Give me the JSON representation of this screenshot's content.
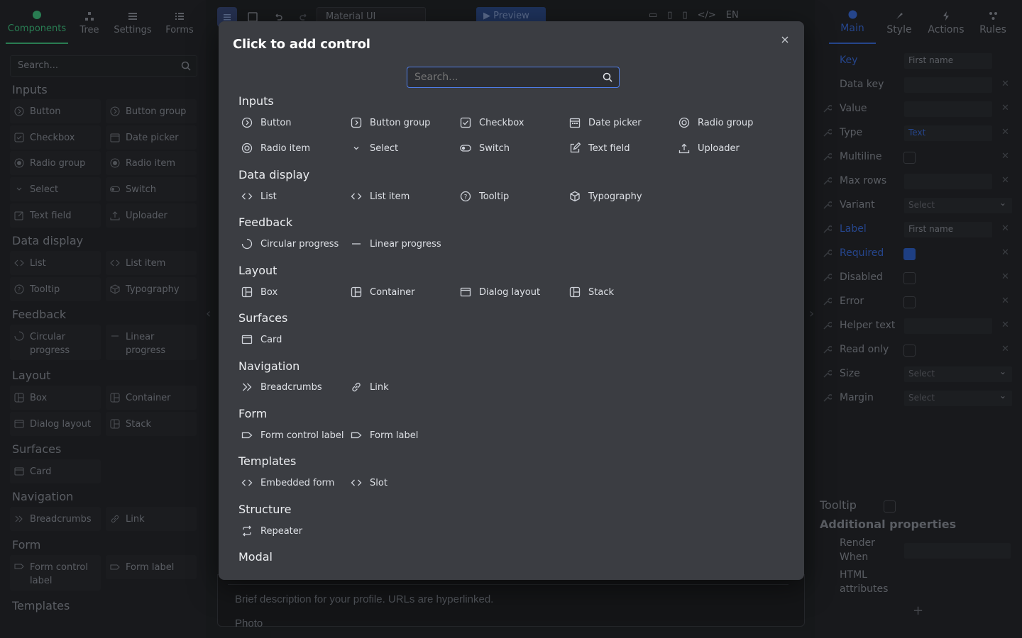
{
  "left_panel": {
    "tabs": [
      {
        "label": "Components",
        "icon": "components-icon"
      },
      {
        "label": "Tree",
        "icon": "tree-icon"
      },
      {
        "label": "Settings",
        "icon": "settings-icon"
      },
      {
        "label": "Forms",
        "icon": "forms-icon"
      }
    ],
    "search_placeholder": "Search...",
    "groups": [
      "Inputs",
      "Data display",
      "Feedback",
      "Layout",
      "Surfaces",
      "Navigation",
      "Form",
      "Templates"
    ],
    "items": {
      "button": "Button",
      "button_group": "Button group",
      "checkbox": "Checkbox",
      "date_picker": "Date picker",
      "radio_group": "Radio group",
      "radio_item": "Radio item",
      "select": "Select",
      "switch": "Switch",
      "text_field": "Text field",
      "uploader": "Uploader",
      "list": "List",
      "list_item": "List item",
      "tooltip": "Tooltip",
      "typography": "Typography",
      "circular_progress": "Circular progress",
      "linear_progress": "Linear progress",
      "box": "Box",
      "container": "Container",
      "dialog_layout": "Dialog layout",
      "stack": "Stack",
      "card": "Card",
      "breadcrumbs": "Breadcrumbs",
      "link": "Link",
      "form_control_label": "Form control label",
      "form_label": "Form label"
    }
  },
  "toolbar": {
    "theme_select": "Material UI",
    "preview_label": "Preview",
    "language": "EN"
  },
  "canvas": {
    "description_text": "Brief description for your profile. URLs are hyperlinked.",
    "photo_label": "Photo"
  },
  "right_panel": {
    "tabs": [
      {
        "label": "Main"
      },
      {
        "label": "Style"
      },
      {
        "label": "Actions"
      },
      {
        "label": "Rules"
      }
    ],
    "props": {
      "key_label": "Key",
      "key_value": "First name",
      "data_key_label": "Data key",
      "value_label": "Value",
      "type_label": "Type",
      "type_value": "Text",
      "multiline_label": "Multiline",
      "max_rows_label": "Max rows",
      "variant_label": "Variant",
      "variant_value": "Select",
      "label_label": "Label",
      "label_value": "First name",
      "required_label": "Required",
      "disabled_label": "Disabled",
      "error_label": "Error",
      "helper_text_label": "Helper text",
      "read_only_label": "Read only",
      "size_label": "Size",
      "size_value": "Select",
      "margin_label": "Margin",
      "margin_value": "Select"
    },
    "tooltip_label": "Tooltip",
    "additional_props_title": "Additional properties",
    "render_when_label": "Render When",
    "html_attributes_label": "HTML attributes",
    "add_symbol": "+"
  },
  "modal": {
    "title": "Click to add control",
    "search_placeholder": "Search...",
    "groups": {
      "inputs": "Inputs",
      "data_display": "Data display",
      "feedback": "Feedback",
      "layout": "Layout",
      "surfaces": "Surfaces",
      "navigation": "Navigation",
      "form": "Form",
      "templates": "Templates",
      "structure": "Structure",
      "modal": "Modal"
    },
    "items": {
      "button": "Button",
      "button_group": "Button group",
      "checkbox": "Checkbox",
      "date_picker": "Date picker",
      "radio_group": "Radio group",
      "radio_item": "Radio item",
      "select": "Select",
      "switch": "Switch",
      "text_field": "Text field",
      "uploader": "Uploader",
      "list": "List",
      "list_item": "List item",
      "tooltip": "Tooltip",
      "typography": "Typography",
      "circular_progress": "Circular progress",
      "linear_progress": "Linear progress",
      "box": "Box",
      "container": "Container",
      "dialog_layout": "Dialog layout",
      "stack": "Stack",
      "card": "Card",
      "breadcrumbs": "Breadcrumbs",
      "link": "Link",
      "form_control_label": "Form control label",
      "form_label": "Form label",
      "embedded_form": "Embedded form",
      "slot": "Slot",
      "repeater": "Repeater"
    }
  },
  "colors": {
    "accent_green": "#3fbf7f",
    "accent_blue": "#3a6ad6",
    "modal_bg": "#3b3d42",
    "search_focus": "#4f7de8"
  }
}
